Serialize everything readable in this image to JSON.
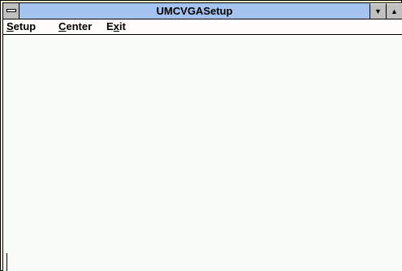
{
  "window": {
    "title": "UMCVGASetup",
    "colors": {
      "titlebar": "#a4c3ef",
      "frame": "#f3f0c6",
      "client": "#f8fbf7",
      "button": "#c0c0c0"
    },
    "controls": {
      "system_menu_icon": "system-menu-icon",
      "minimize_glyph": "▼",
      "maximize_glyph": "▲"
    }
  },
  "menu": {
    "items": [
      {
        "prefix": "",
        "accel": "S",
        "rest": "etup"
      },
      {
        "prefix": "",
        "accel": "C",
        "rest": "enter"
      },
      {
        "prefix": "E",
        "accel": "x",
        "rest": "it"
      }
    ]
  }
}
